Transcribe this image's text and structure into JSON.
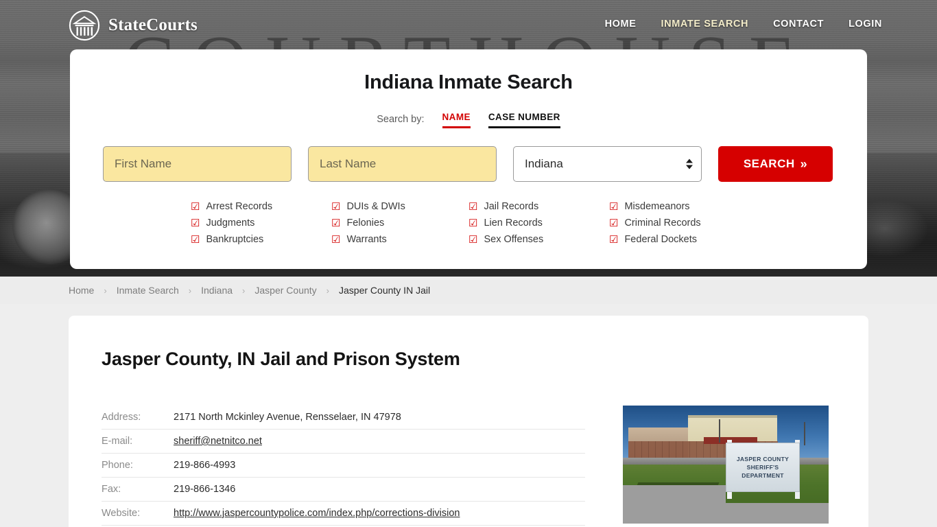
{
  "brand": {
    "name": "StateCourts",
    "logo_icon": "courthouse-circle-icon"
  },
  "nav": {
    "items": [
      {
        "label": "HOME",
        "active": false
      },
      {
        "label": "INMATE SEARCH",
        "active": true
      },
      {
        "label": "CONTACT",
        "active": false
      },
      {
        "label": "LOGIN",
        "active": false
      }
    ]
  },
  "hero": {
    "background_watermark": "COURTHOUSE"
  },
  "search_card": {
    "title": "Indiana Inmate Search",
    "search_by_label": "Search by:",
    "tabs": [
      {
        "label": "NAME",
        "active": true,
        "color": "#d20000"
      },
      {
        "label": "CASE NUMBER",
        "active": false,
        "color": "#111111"
      }
    ],
    "first_name": {
      "value": "",
      "placeholder": "First Name"
    },
    "last_name": {
      "value": "",
      "placeholder": "Last Name"
    },
    "state_select": {
      "value": "Indiana"
    },
    "search_button": {
      "label": "SEARCH",
      "chevron": "»",
      "color": "#d60000"
    },
    "features": [
      {
        "label": "Arrest Records",
        "checkbox": "☑"
      },
      {
        "label": "DUIs & DWIs",
        "checkbox": "☑"
      },
      {
        "label": "Jail Records",
        "checkbox": "☑"
      },
      {
        "label": "Misdemeanors",
        "checkbox": "☑"
      },
      {
        "label": "Judgments",
        "checkbox": "☑"
      },
      {
        "label": "Felonies",
        "checkbox": "☑"
      },
      {
        "label": "Lien Records",
        "checkbox": "☑"
      },
      {
        "label": "Criminal Records",
        "checkbox": "☑"
      },
      {
        "label": "Bankruptcies",
        "checkbox": "☑"
      },
      {
        "label": "Warrants",
        "checkbox": "☑"
      },
      {
        "label": "Sex Offenses",
        "checkbox": "☑"
      },
      {
        "label": "Federal Dockets",
        "checkbox": "☑"
      }
    ]
  },
  "breadcrumb": {
    "separator": "›",
    "items": [
      {
        "label": "Home",
        "current": false
      },
      {
        "label": "Inmate Search",
        "current": false
      },
      {
        "label": "Indiana",
        "current": false
      },
      {
        "label": "Jasper County",
        "current": false
      },
      {
        "label": "Jasper County IN Jail",
        "current": true
      }
    ]
  },
  "content": {
    "title": "Jasper County, IN Jail and Prison System",
    "details": [
      {
        "label": "Address:",
        "value": "2171 North Mckinley Avenue, Rensselaer, IN 47978",
        "link": false
      },
      {
        "label": "E-mail:",
        "value": "sheriff@netnitco.net",
        "link": true
      },
      {
        "label": "Phone:",
        "value": "219-866-4993",
        "link": false
      },
      {
        "label": "Fax:",
        "value": "219-866-1346",
        "link": false
      },
      {
        "label": "Website:",
        "value": "http://www.jaspercountypolice.com/index.php/corrections-division",
        "link": true
      }
    ],
    "photo": {
      "sign_line1": "JASPER COUNTY",
      "sign_line2": "SHERIFF'S",
      "sign_line3": "DEPARTMENT"
    }
  }
}
